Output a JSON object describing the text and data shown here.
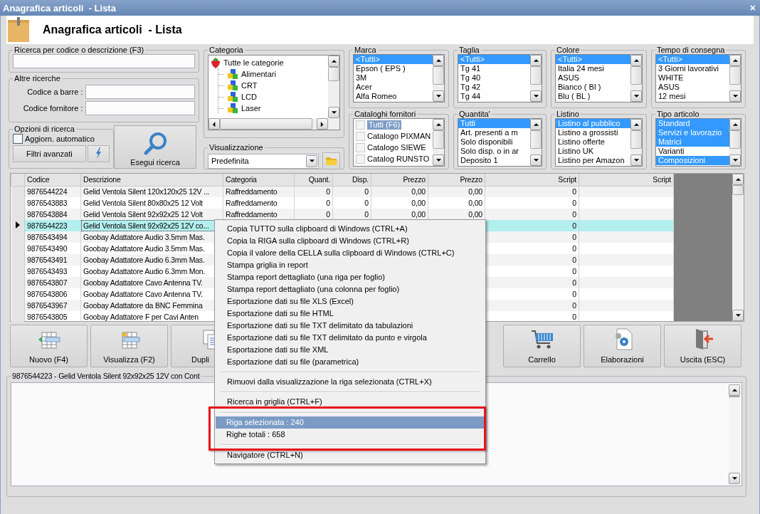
{
  "window": {
    "title": "Anagrafica articoli  - Lista",
    "close": "×"
  },
  "header": {
    "title": "Anagrafica articoli  - Lista"
  },
  "search": {
    "label": "Ricerca per codice o descrizione (F3)"
  },
  "other_searches": {
    "title": "Altre ricerche",
    "fields": [
      {
        "label": "Codice a barre :"
      },
      {
        "label": "Codice fornitore :"
      }
    ]
  },
  "search_options": {
    "title": "Opzioni di ricerca",
    "auto_update": {
      "label": "Aggiorn. automatico",
      "checked": false
    },
    "advanced_filters": "Filtri avanzati"
  },
  "run_search": "Esegui ricerca",
  "category": {
    "title": "Categoria",
    "tree": [
      {
        "label": "Tutte le categorie",
        "children": [
          {
            "label": "Alimentari"
          },
          {
            "label": "CRT"
          },
          {
            "label": "LCD"
          },
          {
            "label": "Laser"
          }
        ]
      }
    ]
  },
  "view": {
    "title": "Visualizzazione",
    "value": "Predefinita"
  },
  "lists": [
    {
      "title": "Marca",
      "kind": "list",
      "items": [
        {
          "label": "<Tutti>",
          "selected": true
        },
        {
          "label": "Epson ( EPS )",
          "selected": false
        },
        {
          "label": "3M",
          "selected": false
        },
        {
          "label": "Acer",
          "selected": false
        },
        {
          "label": "Alfa Romeo",
          "selected": false
        }
      ]
    },
    {
      "title": "Taglia",
      "kind": "list",
      "items": [
        {
          "label": "<Tutti>",
          "selected": true
        },
        {
          "label": "Tg 41",
          "selected": false
        },
        {
          "label": "Tg 40",
          "selected": false
        },
        {
          "label": "Tg 42",
          "selected": false
        },
        {
          "label": "Tg 44",
          "selected": false
        }
      ]
    },
    {
      "title": "Colore",
      "kind": "list",
      "items": [
        {
          "label": "<Tutti>",
          "selected": true
        },
        {
          "label": "Italia 24 mesi",
          "selected": false
        },
        {
          "label": "ASUS",
          "selected": false
        },
        {
          "label": "Bianco ( BI )",
          "selected": false
        },
        {
          "label": "Blu ( BL )",
          "selected": false
        }
      ]
    },
    {
      "title": "Tempo di consegna",
      "kind": "list",
      "items": [
        {
          "label": "<Tutti>",
          "selected": true
        },
        {
          "label": "3 Giorni lavorativi",
          "selected": false
        },
        {
          "label": "WHITE",
          "selected": false
        },
        {
          "label": "ASUS",
          "selected": false
        },
        {
          "label": "12 mesi",
          "selected": false
        }
      ]
    },
    {
      "title": "Cataloghi fornitori",
      "kind": "checklist",
      "items": [
        {
          "label": "Tutti (F6)",
          "selected": true,
          "checked": false
        },
        {
          "label": "Catalogo PIXMAN",
          "selected": false,
          "checked": false
        },
        {
          "label": "Catalogo SIEWE",
          "selected": false,
          "checked": false
        },
        {
          "label": "Catalog RUNSTO",
          "selected": false,
          "checked": false
        }
      ]
    },
    {
      "title": "Quantita'",
      "kind": "list",
      "items": [
        {
          "label": "Tutti",
          "selected": true
        },
        {
          "label": "Art. presenti a m",
          "selected": false
        },
        {
          "label": "Solo disponibili",
          "selected": false
        },
        {
          "label": "Solo disp. o in ar",
          "selected": false
        },
        {
          "label": "Deposito 1",
          "selected": false
        }
      ]
    },
    {
      "title": "Listino",
      "kind": "list",
      "items": [
        {
          "label": "Listino al pubblico",
          "selected": true
        },
        {
          "label": "Listino a grossisti",
          "selected": false
        },
        {
          "label": "Listino offerte",
          "selected": false
        },
        {
          "label": "Listino UK",
          "selected": false
        },
        {
          "label": "Listino per Amazon",
          "selected": false
        }
      ]
    },
    {
      "title": "Tipo articolo",
      "kind": "list",
      "items": [
        {
          "label": "Standard",
          "selected": true
        },
        {
          "label": "Servizi e lavorazio",
          "selected": true
        },
        {
          "label": "Matrici",
          "selected": true
        },
        {
          "label": "Varianti",
          "selected": false
        },
        {
          "label": "Composizioni",
          "selected": true
        }
      ]
    }
  ],
  "grid": {
    "columns": [
      "Codice",
      "Descrizione",
      "Categoria",
      "Quant.",
      "Disp.",
      "Prezzo",
      "Prezzo",
      "Script",
      "Script"
    ],
    "rows": [
      {
        "selected": false,
        "cells": [
          "9876544224",
          "Gelid Ventola Silent 120x120x25 12V ...",
          "Raffreddamento",
          "0",
          "0",
          "0,00",
          "0,00",
          "0"
        ]
      },
      {
        "selected": false,
        "cells": [
          "9876543883",
          "Gelid Ventola Silent 80x80x25 12 Volt",
          "Raffreddamento",
          "0",
          "0",
          "0,00",
          "0,00",
          "0"
        ]
      },
      {
        "selected": false,
        "cells": [
          "9876543884",
          "Gelid Ventola Silent 92x92x25 12 Volt",
          "Raffreddamento",
          "0",
          "0",
          "0,00",
          "0,00",
          "0"
        ]
      },
      {
        "selected": true,
        "cells": [
          "9876544223",
          "Gelid Ventola Silent 92x92x25 12V co...",
          null,
          null,
          null,
          null,
          null,
          "0"
        ]
      },
      {
        "selected": false,
        "cells": [
          "9876543494",
          "Goobay Adattatore Audio 3.5mm Mas.",
          null,
          null,
          null,
          null,
          null,
          "0"
        ]
      },
      {
        "selected": false,
        "cells": [
          "9876543490",
          "Goobay Adattatore Audio 3.5mm Mas.",
          null,
          null,
          null,
          null,
          null,
          "0"
        ]
      },
      {
        "selected": false,
        "cells": [
          "9876543491",
          "Goobay Adattatore Audio 6.3mm Mas.",
          null,
          null,
          null,
          null,
          null,
          "0"
        ]
      },
      {
        "selected": false,
        "cells": [
          "9876543493",
          "Goobay Adattatore Audio 6.3mm Mon.",
          null,
          null,
          null,
          null,
          null,
          "0"
        ]
      },
      {
        "selected": false,
        "cells": [
          "9876543807",
          "Goobay Adattatore Cavo Antenna TV.",
          null,
          null,
          null,
          null,
          null,
          "0"
        ]
      },
      {
        "selected": false,
        "cells": [
          "9876543806",
          "Goobay Adattatore Cavo Antenna TV.",
          null,
          null,
          null,
          null,
          null,
          "0"
        ]
      },
      {
        "selected": false,
        "cells": [
          "9876543967",
          "Goobay Adattatore da BNC Femmina",
          null,
          null,
          null,
          null,
          null,
          "0"
        ]
      },
      {
        "selected": false,
        "cells": [
          "9876543805",
          "Goobay Adattatore F per Cavi Anten",
          null,
          null,
          null,
          null,
          null,
          "0"
        ]
      }
    ]
  },
  "buttons": [
    {
      "kind": "new",
      "label": "Nuovo (F4)"
    },
    {
      "kind": "view",
      "label": "Visualizza (F2)"
    },
    {
      "kind": "duplicate",
      "label": "Dupli"
    },
    {
      "kind": "cart",
      "label": "Carrello"
    },
    {
      "kind": "process",
      "label": "Elaborazioni"
    },
    {
      "kind": "exit",
      "label": "Uscita (ESC)"
    }
  ],
  "details": {
    "title": "9876544223 - Gelid Ventola Silent 92x92x25 12V con Cont"
  },
  "menu": {
    "items": [
      {
        "kind": "item",
        "label": "Copia TUTTO sulla clipboard di Windows (CTRL+A)",
        "selected": false,
        "framed": false
      },
      {
        "kind": "item",
        "label": "Copia la RIGA sulla clipboard di Windows (CTRL+R)",
        "selected": false,
        "framed": false
      },
      {
        "kind": "item",
        "label": "Copia il valore della CELLA sulla clipboard di Windows (CTRL+C)",
        "selected": false,
        "framed": false
      },
      {
        "kind": "item",
        "label": "Stampa griglia in report",
        "selected": false,
        "framed": false
      },
      {
        "kind": "item",
        "label": "Stampa report dettagliato (una riga per foglio)",
        "selected": false,
        "framed": false
      },
      {
        "kind": "item",
        "label": "Stampa report dettagliato (una colonna per foglio)",
        "selected": false,
        "framed": false
      },
      {
        "kind": "item",
        "label": "Esportazione dati su file XLS (Excel)",
        "selected": false,
        "framed": false
      },
      {
        "kind": "item",
        "label": "Esportazione dati su file HTML",
        "selected": false,
        "framed": false
      },
      {
        "kind": "item",
        "label": "Esportazione dati su file TXT delimitato da tabulazioni",
        "selected": false,
        "framed": false
      },
      {
        "kind": "item",
        "label": "Esportazione dati su file TXT delimitato da punto e virgola",
        "selected": false,
        "framed": false
      },
      {
        "kind": "item",
        "label": "Esportazione dati su file XML",
        "selected": false,
        "framed": false
      },
      {
        "kind": "item",
        "label": "Esportazione dati su file (parametrica)",
        "selected": false,
        "framed": false
      },
      {
        "kind": "separator",
        "framed": false
      },
      {
        "kind": "item",
        "label": "Rimuovi dalla visualizzazione la riga selezionata (CTRL+X)",
        "selected": false,
        "framed": false
      },
      {
        "kind": "separator",
        "framed": false
      },
      {
        "kind": "item",
        "label": "Ricerca in griglia (CTRL+F)",
        "selected": false,
        "framed": false
      },
      {
        "kind": "separator",
        "framed": true
      },
      {
        "kind": "item",
        "label": "Riga selezionata : 240",
        "selected": true,
        "framed": true
      },
      {
        "kind": "item",
        "label": "Righe totali : 658",
        "selected": false,
        "framed": true
      },
      {
        "kind": "separator",
        "framed": true
      },
      {
        "kind": "item",
        "label": "Navigatore (CTRL+N)",
        "selected": false,
        "framed": false
      }
    ]
  }
}
